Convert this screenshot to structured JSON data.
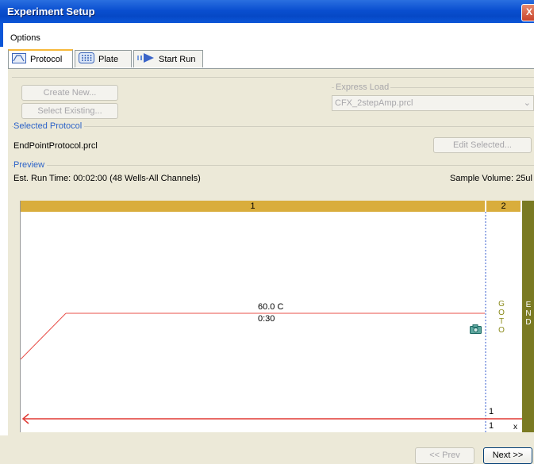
{
  "window": {
    "title": "Experiment Setup",
    "close_glyph": "X"
  },
  "menu": {
    "options_label": "Options"
  },
  "tabs": [
    {
      "label": "Protocol",
      "icon": "protocol-icon"
    },
    {
      "label": "Plate",
      "icon": "plate-icon"
    },
    {
      "label": "Start Run",
      "icon": "start-run-icon"
    }
  ],
  "buttons": {
    "create_new": "Create New...",
    "select_existing": "Select Existing...",
    "edit_selected": "Edit Selected..."
  },
  "express_load": {
    "label": "Express Load",
    "value": "CFX_2stepAmp.prcl"
  },
  "selected_protocol": {
    "label": "Selected Protocol",
    "filename": "EndPointProtocol.prcl"
  },
  "preview": {
    "label": "Preview",
    "run_time": "Est. Run Time:  00:02:00   (48 Wells-All Channels)",
    "sample_volume": "Sample Volume:  25ul"
  },
  "graph": {
    "step1_label": "1",
    "step2_label": "2",
    "temp_label": "60.0  C",
    "time_label": "0:30",
    "goto_letters": [
      "G",
      "O",
      "T",
      "O"
    ],
    "end_letters": [
      "E",
      "N",
      "D"
    ],
    "goto_target": "1",
    "goto_count": "1",
    "x_mark": "x",
    "colors": {
      "header": "#d9ad3c",
      "end": "#7a7a22",
      "line": "#e8504a",
      "goto_text": "#8a8a1a",
      "dashed": "#3a5fcf"
    },
    "camera_icon": "camera-icon"
  },
  "nav": {
    "prev": "<< Prev",
    "next": "Next >>"
  }
}
